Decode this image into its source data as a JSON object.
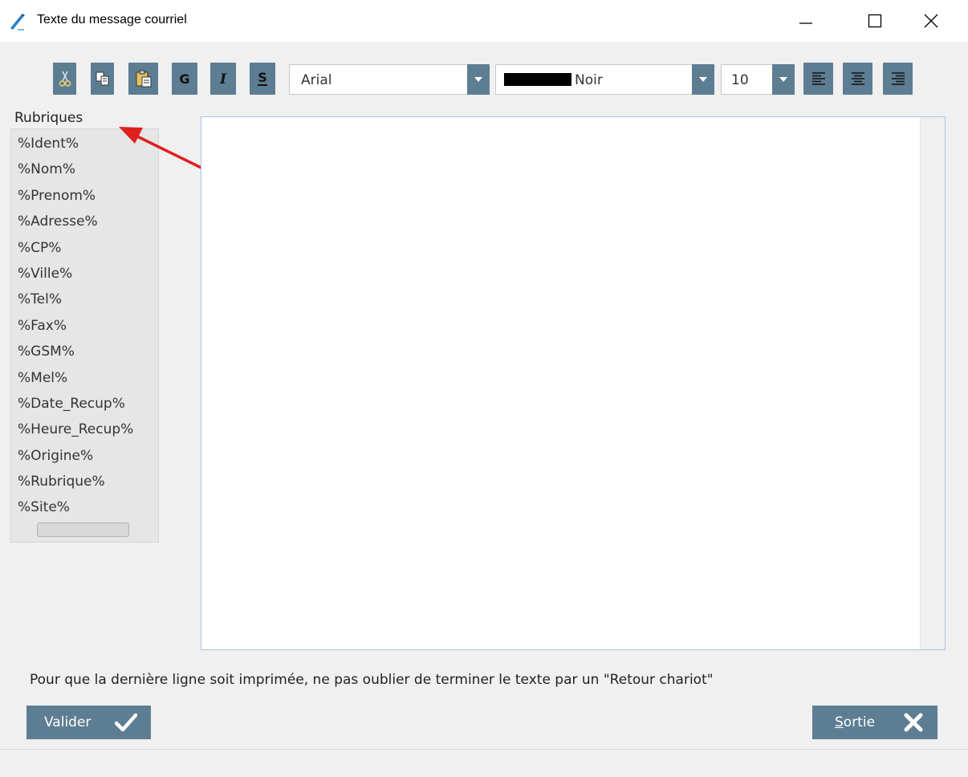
{
  "window": {
    "title": "Texte du message courriel",
    "app_icon": "pen-icon",
    "controls": [
      "minimize-icon",
      "maximize-icon",
      "close-icon"
    ]
  },
  "toolbar": {
    "buttons": [
      {
        "name": "cut",
        "icon": "scissors-icon",
        "glyph": "✂"
      },
      {
        "name": "copy",
        "icon": "copy-icon"
      },
      {
        "name": "paste",
        "icon": "paste-icon"
      },
      {
        "name": "bold",
        "icon": "bold-icon",
        "glyph": "G"
      },
      {
        "name": "italic",
        "icon": "italic-icon",
        "glyph": "I"
      },
      {
        "name": "strike",
        "icon": "strikethrough-icon",
        "glyph": "S"
      },
      {
        "name": "align-left",
        "icon": "align-left-icon"
      },
      {
        "name": "align-center",
        "icon": "align-center-icon"
      },
      {
        "name": "align-right",
        "icon": "align-right-icon"
      }
    ],
    "font": {
      "value": "Arial"
    },
    "color": {
      "value": "Noir",
      "swatch": "#000000"
    },
    "size": {
      "value": "10"
    }
  },
  "rubriques": {
    "label": "Rubriques",
    "items": [
      "%Ident%",
      "%Nom%",
      "%Prenom%",
      "%Adresse%",
      "%CP%",
      "%Ville%",
      "%Tel%",
      "%Fax%",
      "%GSM%",
      "%Mel%",
      "%Date_Recup%",
      "%Heure_Recup%",
      "%Origine%",
      "%Rubrique%",
      "%Site%"
    ]
  },
  "editor": {
    "value": ""
  },
  "note": "Pour que la dernière ligne soit imprimée, ne pas oublier de terminer le texte par un \"Retour chariot\"",
  "buttons": {
    "valider": "Valider",
    "sortie_first": "S",
    "sortie_rest": "ortie"
  },
  "colors": {
    "accent": "#5d7d93",
    "annotation_arrow": "#e0201f",
    "editor_border": "#a8c4e4"
  }
}
